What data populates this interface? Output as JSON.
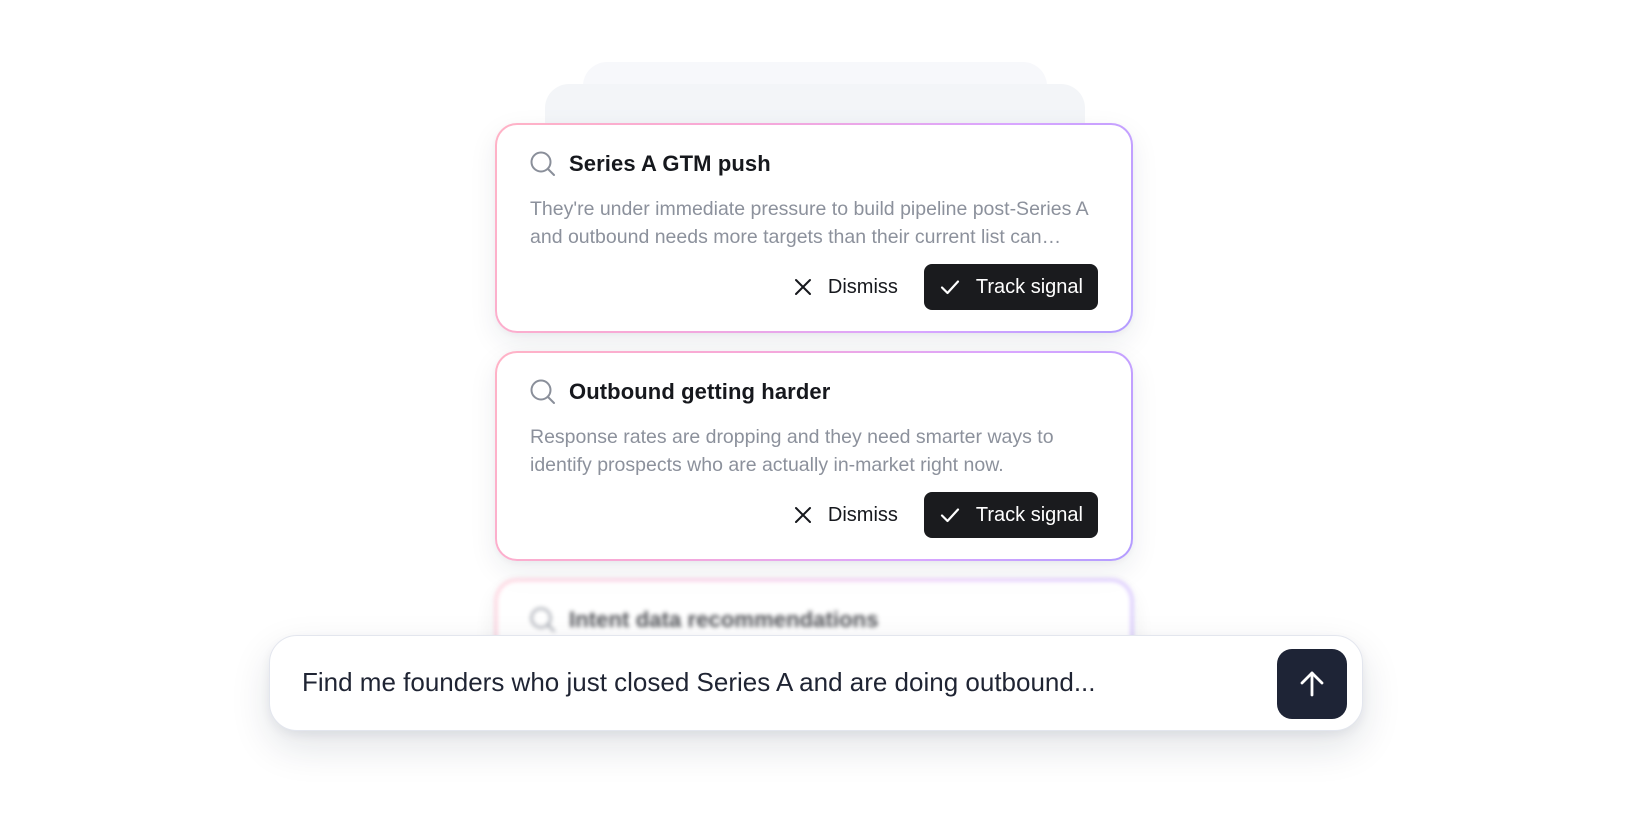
{
  "cards": [
    {
      "title": "Series A GTM push",
      "description": "They're under immediate pressure to build pipeline post-Series A and outbound needs more targets than their current list can supply.",
      "dismiss_label": "Dismiss",
      "track_label": "Track signal"
    },
    {
      "title": "Outbound getting harder",
      "description": "Response rates are dropping and they need smarter ways to identify prospects who are actually in-market right now.",
      "dismiss_label": "Dismiss",
      "track_label": "Track signal"
    },
    {
      "title": "Intent data recommendations"
    }
  ],
  "composer": {
    "value": "Find me founders who just closed Series A and are doing outbound..."
  },
  "icons": {
    "card_icon": "search-icon",
    "dismiss_icon": "close-icon",
    "track_icon": "check-icon",
    "send_icon": "arrow-up-icon"
  },
  "colors": {
    "track_button": "#1a1b1e",
    "send_button": "#1e2436",
    "card_border_gradient": [
      "#ffb3c6",
      "#d9a6ff"
    ]
  }
}
